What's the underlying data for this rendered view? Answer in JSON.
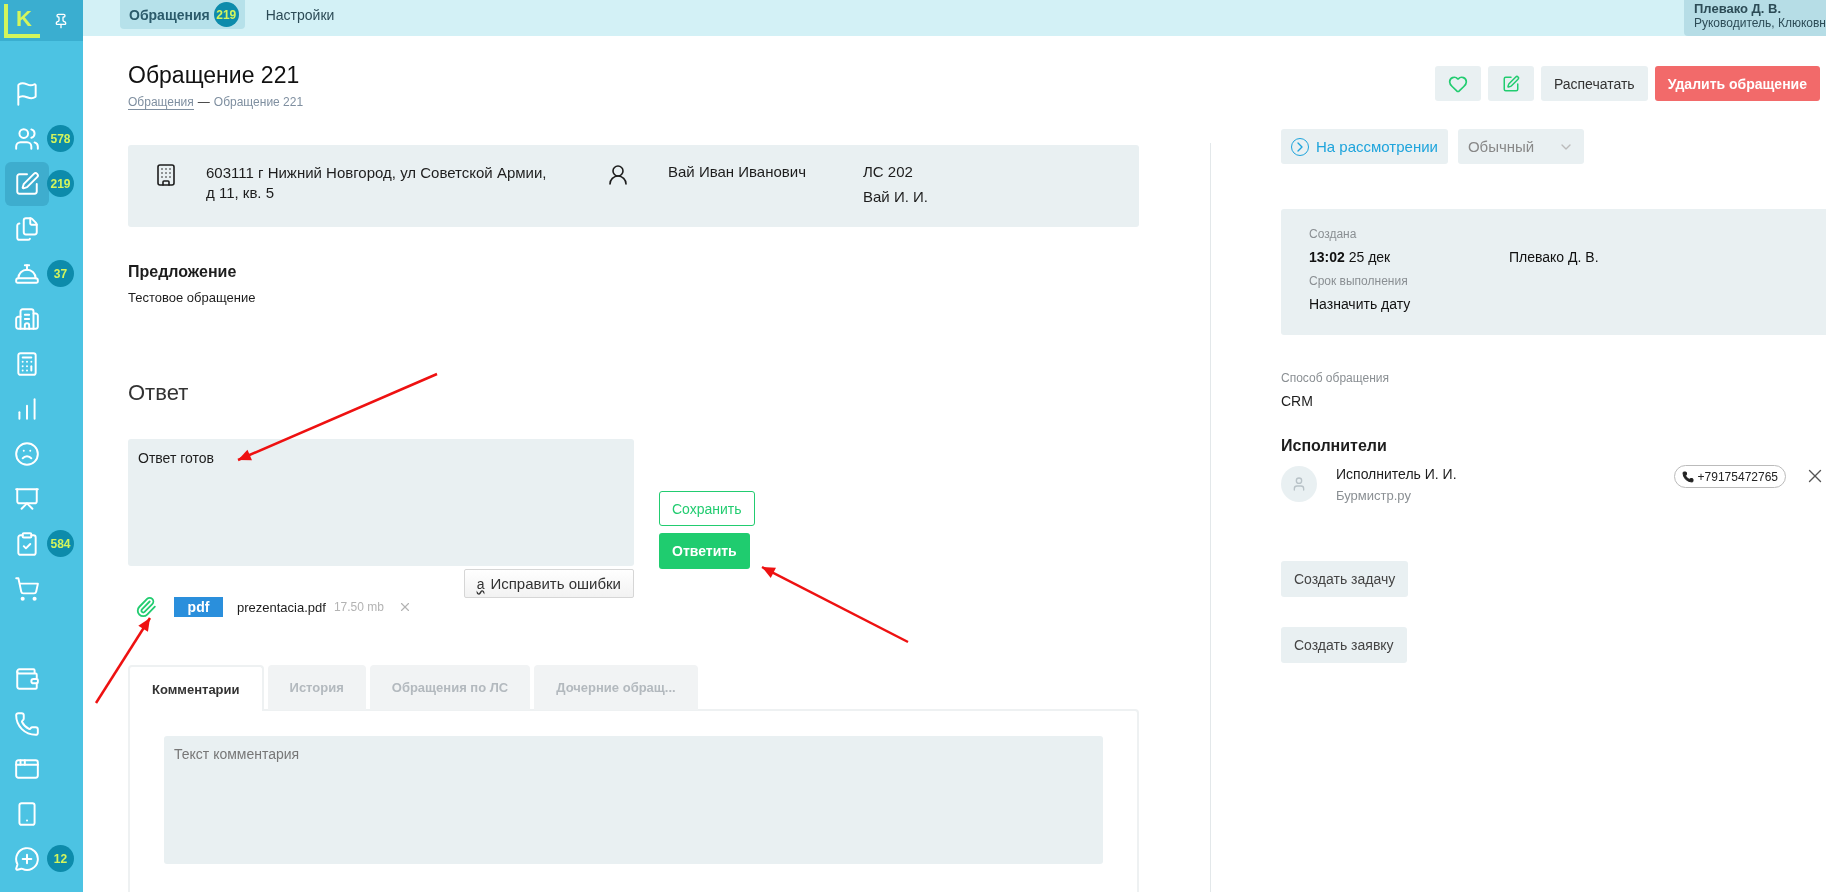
{
  "sidebar": {
    "logo": "K",
    "groups": [
      [
        {
          "selected": false
        },
        {
          "badge": "578",
          "selected": false
        },
        {
          "badge": "219",
          "selected": true
        },
        {
          "selected": false
        },
        {
          "badge": "37",
          "selected": false
        },
        {
          "selected": false
        },
        {
          "selected": false
        },
        {
          "selected": false
        },
        {
          "selected": false
        },
        {
          "selected": false
        },
        {
          "badge": "584",
          "selected": false
        },
        {
          "selected": false
        }
      ],
      [
        {
          "selected": false
        },
        {
          "selected": false
        },
        {
          "selected": false
        },
        {
          "selected": false
        },
        {
          "badge": "12",
          "selected": false
        }
      ]
    ]
  },
  "top_tabs": [
    {
      "label": "Обращения",
      "badge": "219",
      "selected": true
    },
    {
      "label": "Настройки",
      "selected": false
    }
  ],
  "user": {
    "name": "Плевако Д. В.",
    "role": "Руководитель, Клюковн"
  },
  "page": {
    "title": "Обращение 221",
    "breadcrumb": {
      "link": "Обращения",
      "separator": "—",
      "current": "Обращение 221"
    }
  },
  "actions": {
    "print": "Распечатать",
    "delete": "Удалить обращение"
  },
  "subject": {
    "address_lines": [
      "603111 г Нижний Новгород, ул Советской Армии,",
      "д 11, кв. 5"
    ],
    "person": "Вай Иван Иванович",
    "account": "ЛС 202",
    "account_holder": "Вай И. И."
  },
  "proposal": {
    "heading": "Предложение",
    "text": "Тестовое обращение"
  },
  "answer": {
    "heading": "Ответ",
    "value": "Ответ готов",
    "fix_icon": "a",
    "fix_button": "Исправить ошибки",
    "save_button": "Сохранить",
    "reply_button": "Ответить",
    "attachments": [
      {
        "type": "pdf",
        "name": "prezentacia.pdf",
        "size": "17.50 mb"
      }
    ]
  },
  "tabs": [
    {
      "label": "Комментарии",
      "selected": true
    },
    {
      "label": "История",
      "selected": false
    },
    {
      "label": "Обращения по ЛС",
      "selected": false
    },
    {
      "label": "Дочерние обращ...",
      "selected": false
    }
  ],
  "comment": {
    "placeholder": "Текст комментария"
  },
  "status": {
    "label": "На рассмотрении",
    "priority": "Обычный"
  },
  "info": {
    "created_label": "Создана",
    "created_time": "13:02",
    "created_date": "25 дек",
    "author": "Плевако Д. В.",
    "due_label": "Срок выполнения",
    "due_value": "Назначить дату"
  },
  "channel": {
    "label": "Способ обращения",
    "value": "CRM"
  },
  "executors": {
    "heading": "Исполнители",
    "items": [
      {
        "name": "Исполнитель И. И.",
        "company": "Бурмистр.ру",
        "phone": "+79175472765"
      }
    ]
  },
  "create_buttons": [
    "Создать задачу",
    "Создать заявку"
  ]
}
